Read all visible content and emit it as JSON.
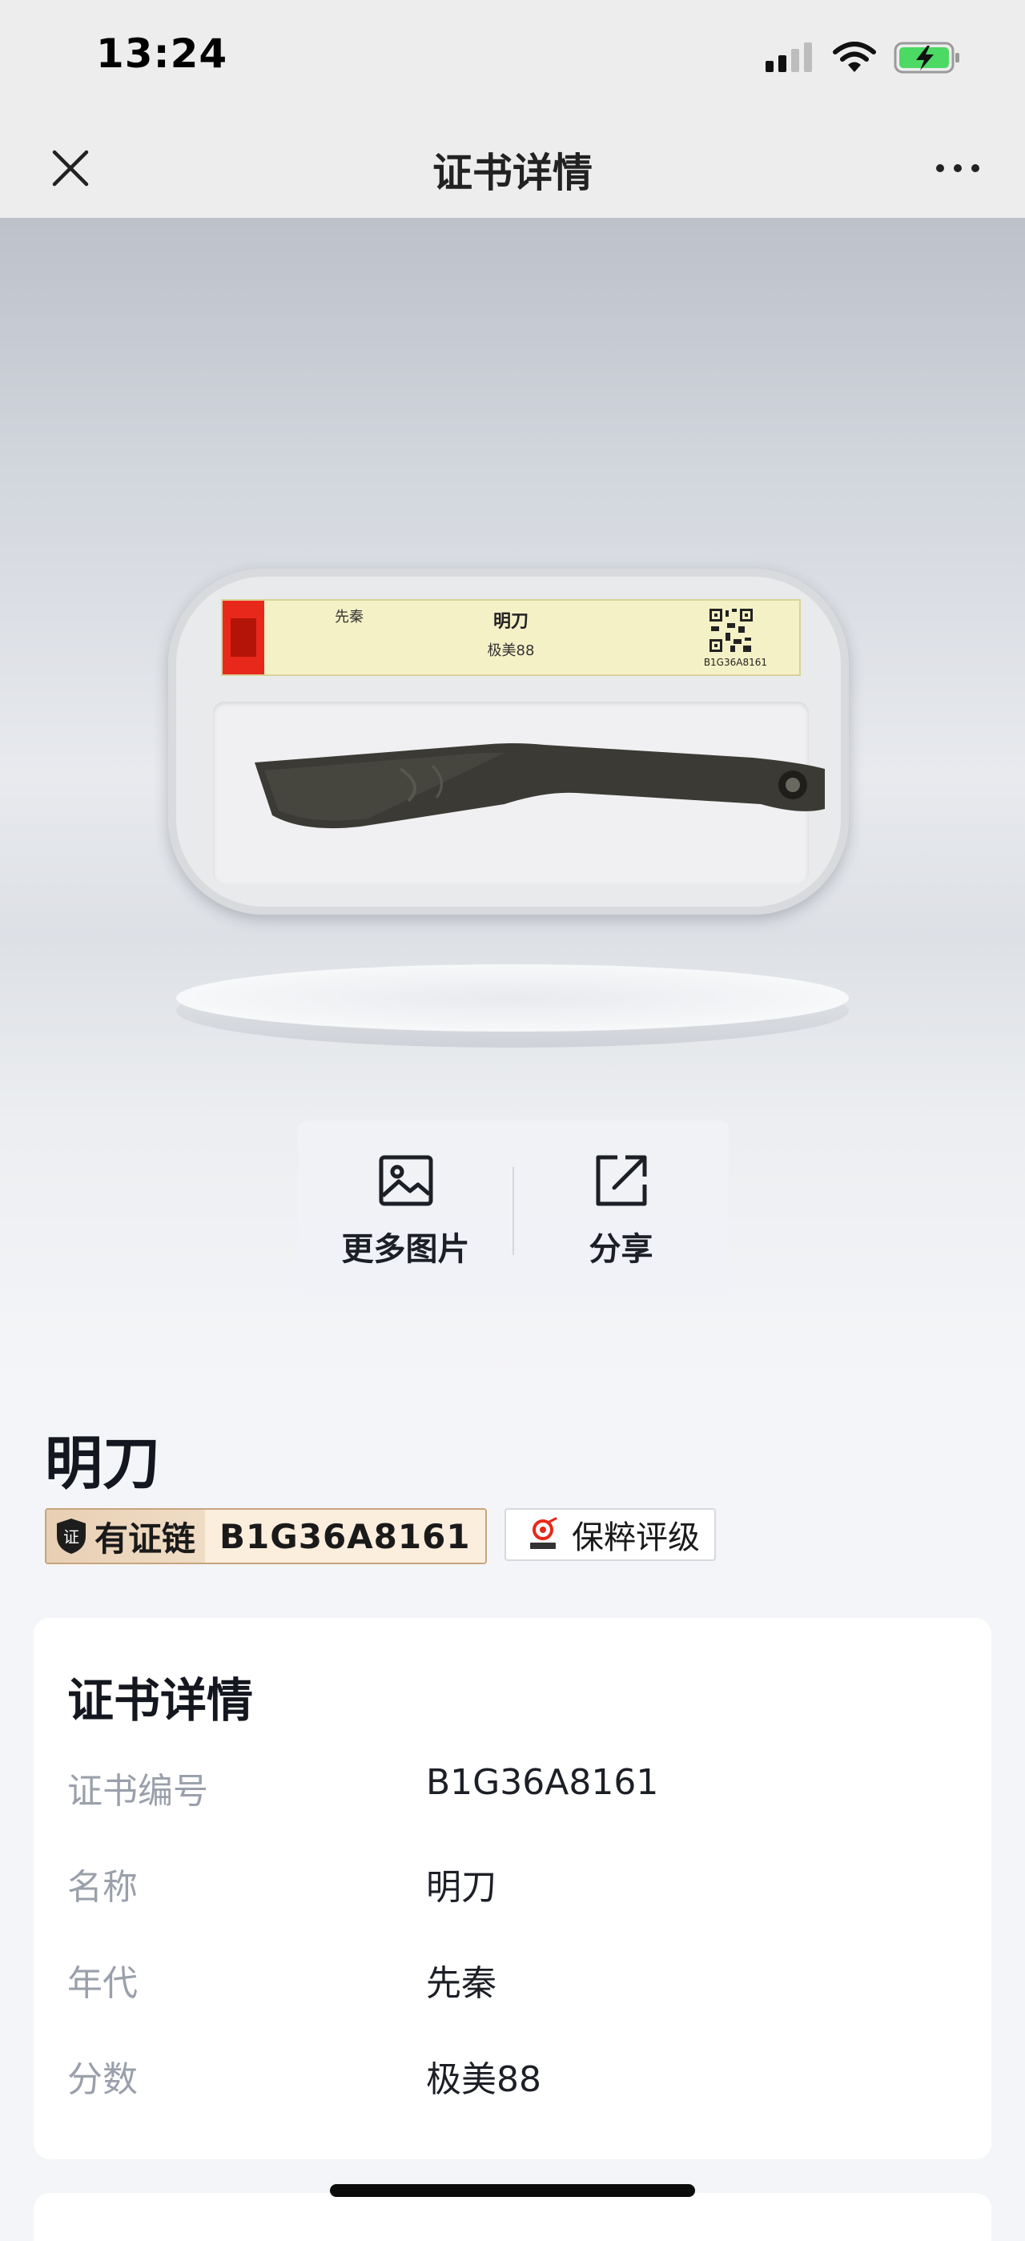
{
  "status_bar": {
    "time": "13:24",
    "icons": [
      "cellular-signal-icon",
      "wifi-icon",
      "battery-charging-icon"
    ]
  },
  "nav": {
    "title": "证书详情",
    "close_icon": "close-icon",
    "more_icon": "more-horizontal-icon"
  },
  "slab": {
    "era": "先秦",
    "name": "明刀",
    "grade": "极美88",
    "cert": "B1G36A8161"
  },
  "actions": {
    "more_images": "更多图片",
    "share": "分享"
  },
  "item": {
    "title": "明刀",
    "chain_label": "有证链",
    "chain_code": "B1G36A8161",
    "grading_label": "保粹评级"
  },
  "details": {
    "heading": "证书详情",
    "rows": [
      {
        "label": "证书编号",
        "value": "B1G36A8161"
      },
      {
        "label": "名称",
        "value": "明刀"
      },
      {
        "label": "年代",
        "value": "先秦"
      },
      {
        "label": "分数",
        "value": "极美88"
      }
    ]
  },
  "colors": {
    "chain_badge_left": "#e8cfb3",
    "chain_badge_right": "#fbeedd",
    "label_gray": "#9aa0ab",
    "brand_red": "#e8281a"
  }
}
